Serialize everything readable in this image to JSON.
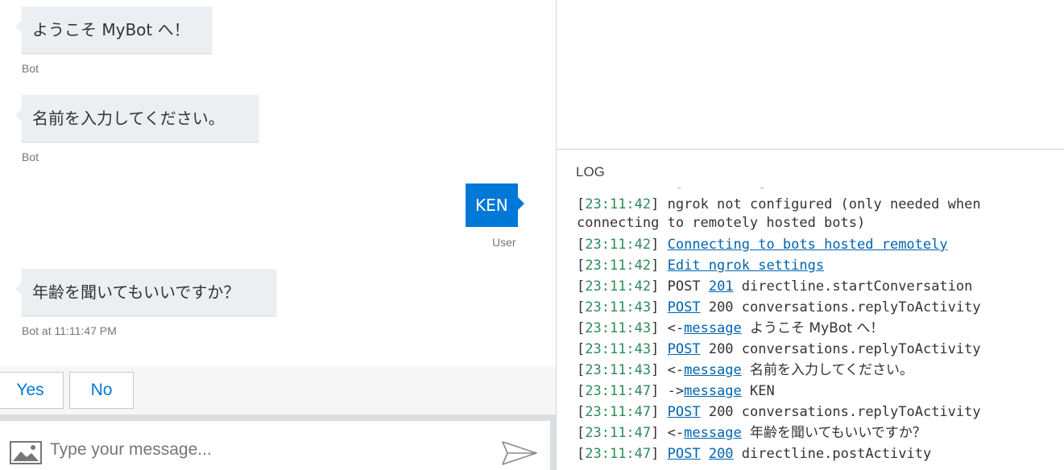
{
  "chat": {
    "messages": [
      {
        "text": "ようこそ MyBot へ！",
        "meta": "Bot"
      },
      {
        "text": "名前を入力してください。",
        "meta": "Bot"
      },
      {
        "text": "KEN",
        "meta": "User"
      },
      {
        "text": "年齢を聞いてもいいですか？",
        "meta": "Bot at 11:11:47 PM"
      }
    ],
    "suggested_actions": [
      "Yes",
      "No"
    ],
    "input": {
      "placeholder": "Type your message...",
      "value": ""
    }
  },
  "log": {
    "title": "LOG",
    "lines": [
      {
        "ts": "23:11:42",
        "text": "ngrok not configured (only needed when connecting to remotely hosted bots)"
      },
      {
        "ts": "23:11:42",
        "link": "Connecting to bots hosted remotely"
      },
      {
        "ts": "23:11:42",
        "link": "Edit ngrok settings"
      },
      {
        "ts": "23:11:42",
        "method": "POST",
        "status": "201",
        "op": "directline.startConversation"
      },
      {
        "ts": "23:11:43",
        "method": "POST",
        "status": "200",
        "op": "conversations.replyToActivity"
      },
      {
        "ts": "23:11:43",
        "dir": "<-",
        "link": "message",
        "msg": "ようこそ MyBot へ！"
      },
      {
        "ts": "23:11:43",
        "method": "POST",
        "status": "200",
        "op": "conversations.replyToActivity"
      },
      {
        "ts": "23:11:43",
        "dir": "<-",
        "link": "message",
        "msg": "名前を入力してください。"
      },
      {
        "ts": "23:11:47",
        "dir": "->",
        "link": "message",
        "msg": "KEN"
      },
      {
        "ts": "23:11:47",
        "method": "POST",
        "status": "200",
        "op": "conversations.replyToActivity"
      },
      {
        "ts": "23:11:47",
        "dir": "<-",
        "link": "message",
        "msg": "年齢を聞いてもいいですか？"
      },
      {
        "ts": "23:11:47",
        "method": "POST",
        "status": "200",
        "op": "directline.postActivity"
      }
    ]
  },
  "colors": {
    "accent": "#0078d7",
    "timestamp": "#2e8b57",
    "bot_bubble": "#eceff1"
  }
}
